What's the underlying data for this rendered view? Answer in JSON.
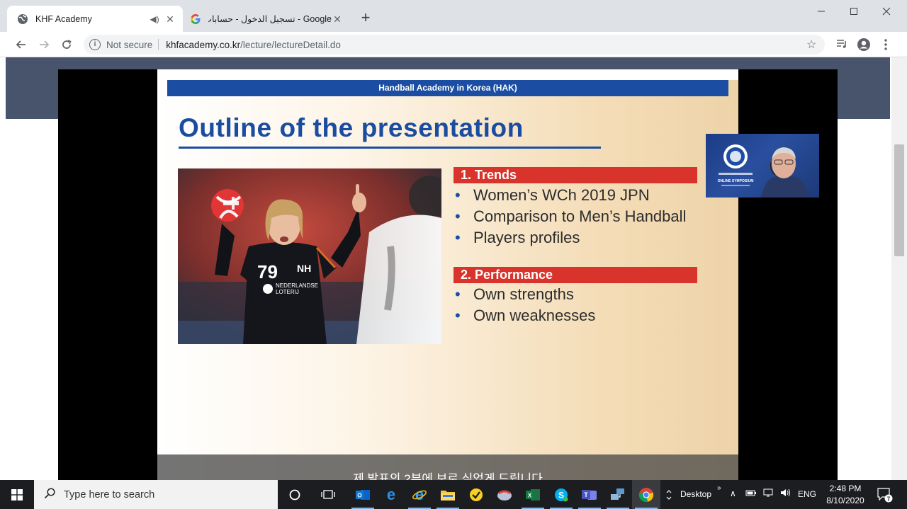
{
  "browser": {
    "tabs": [
      {
        "title": "KHF Academy",
        "active": true
      },
      {
        "title": "Google - تسجيل الدخول - حسابات",
        "active": false
      }
    ],
    "address": {
      "security_label": "Not secure",
      "host": "khfacademy.co.kr",
      "path": "/lecture/lectureDetail.do"
    }
  },
  "slide": {
    "banner": "Handball Academy in Korea (HAK)",
    "title": "Outline of the presentation",
    "photo": {
      "jersey_number": "79",
      "sponsor_line1": "NEDERLANDSE",
      "sponsor_line2": "LOTERIJ",
      "brand": "NH"
    },
    "sections": [
      {
        "heading": "1. Trends",
        "items": [
          "Women’s WCh 2019 JPN",
          "Comparison to Men’s Handball",
          "Players profiles"
        ]
      },
      {
        "heading": "2. Performance",
        "items": [
          "Own strengths",
          "Own weaknesses"
        ]
      }
    ],
    "bullet_char": "•",
    "subtitle": "제 발표의 2부에 보로 싶었게 드립니다",
    "webcam": {
      "caption": "ONLINE SYMPOSIUM"
    }
  },
  "taskbar": {
    "search_placeholder": "Type here to search",
    "desktop_label": "Desktop",
    "lang": "ENG",
    "time": "2:48 PM",
    "date": "8/10/2020",
    "notification_count": "7"
  },
  "colors": {
    "slide_blue": "#1b4ea3",
    "slide_red": "#d8342c",
    "page_header": "#47546c",
    "taskbar": "#1c1d20"
  }
}
